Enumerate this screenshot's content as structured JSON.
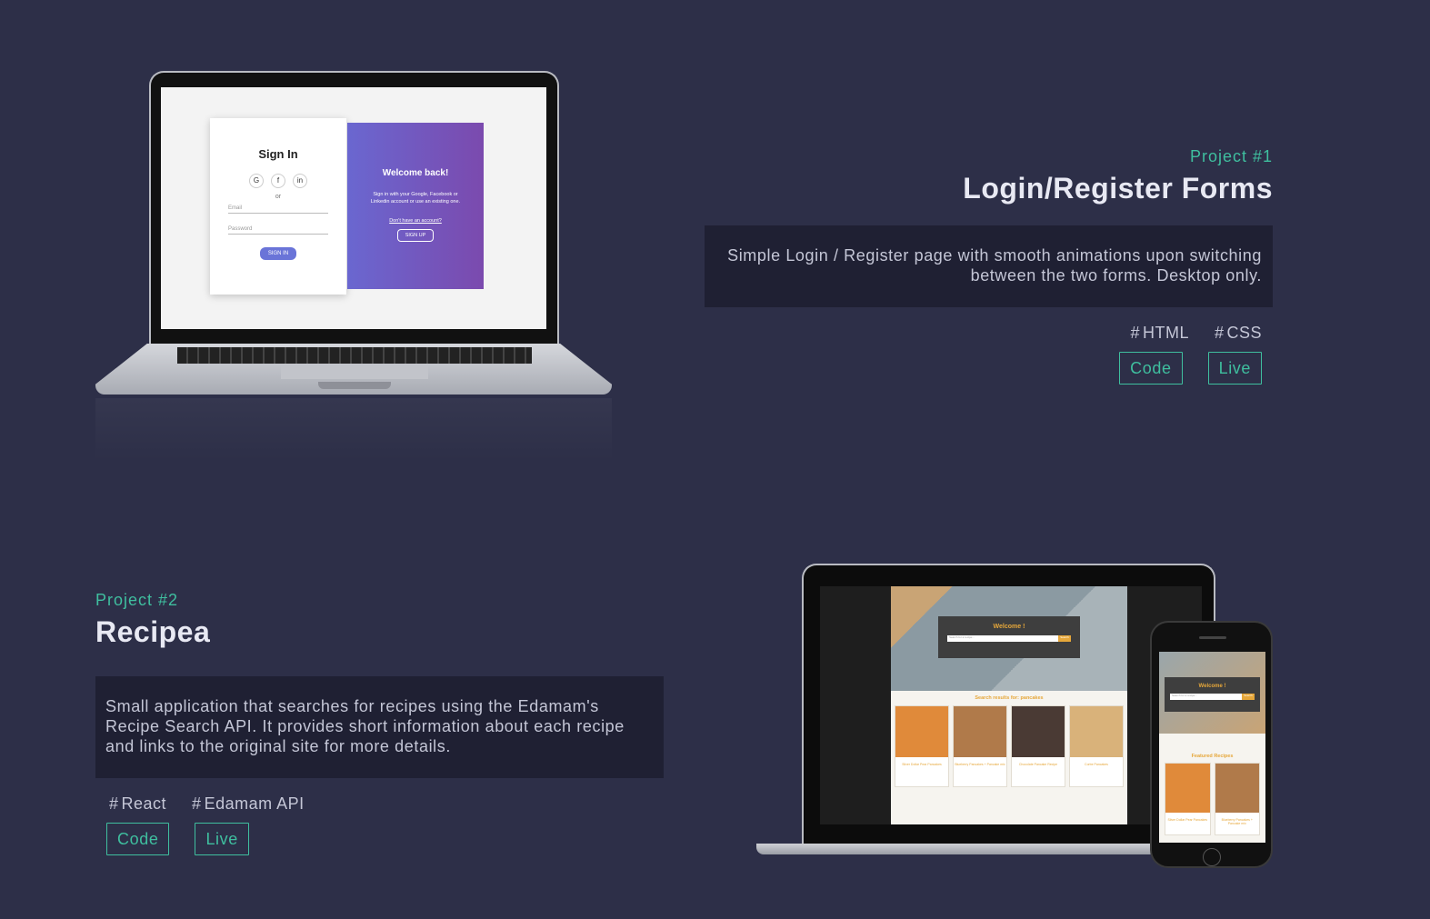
{
  "projects": [
    {
      "label": "Project #1",
      "title": "Login/Register Forms",
      "description": "Simple Login / Register page with smooth animations upon switching between the two forms. Desktop only.",
      "tags": [
        "HTML",
        "CSS"
      ],
      "buttons": {
        "code": "Code",
        "live": "Live"
      },
      "preview": {
        "signin_title": "Sign In",
        "social": [
          "G",
          "f",
          "in"
        ],
        "or_text": "or",
        "email_placeholder": "Email",
        "password_placeholder": "Password",
        "signin_button": "SIGN IN",
        "welcome_title": "Welcome back!",
        "welcome_text": "Sign in with your Google, Facebook or Linkedin account or use an existing one.",
        "no_account": "Don't have an account?",
        "signup_button": "SIGN UP"
      }
    },
    {
      "label": "Project #2",
      "title": "Recipea",
      "description": "Small application that searches for recipes using the Edamam's Recipe Search API. It provides short information about each recipe and links to the original site for more details.",
      "tags": [
        "React",
        "Edamam API"
      ],
      "buttons": {
        "code": "Code",
        "live": "Live"
      },
      "preview": {
        "welcome": "Welcome !",
        "search_placeholder": "Search for a recipe...",
        "search_button": "Search",
        "results_title": "Search results for: pancakes",
        "featured_title": "Featured Recipes",
        "cards": [
          {
            "name": "Silver Dollar Pear Pancakes",
            "color": "#e08a3a"
          },
          {
            "name": "Blueberry Pancakes + Pancake mix",
            "color": "#b07a4a"
          },
          {
            "name": "Chocolate Pancake Recipe",
            "color": "#4a3a34"
          },
          {
            "name": "Corbe Pancakes",
            "color": "#d9b27a"
          }
        ]
      }
    }
  ],
  "colors": {
    "accent": "#3fbf9f",
    "background": "#2d2f48",
    "panel": "#1f2033"
  }
}
